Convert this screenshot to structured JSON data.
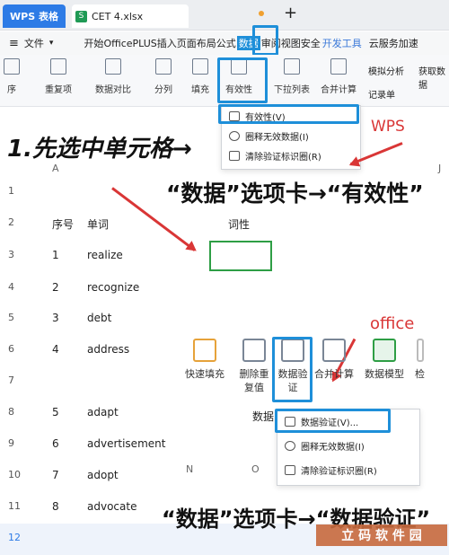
{
  "titlebar": {
    "app_tab": "WPS 表格",
    "file_tab": "CET 4.xlsx",
    "new_tab": "+"
  },
  "menubar": {
    "file_menu": "文件",
    "items": [
      "开始",
      "OfficePLUS",
      "插入",
      "页面布局",
      "公式",
      "数据",
      "审阅",
      "视图",
      "安全",
      "开发工具",
      "云服务",
      "加速"
    ],
    "highlighted_tab": "数据"
  },
  "ribbon": {
    "left_labels": [
      "序",
      "重复项",
      "数据对比",
      "分列",
      "填充",
      "有效性",
      "下拉列表",
      "合并计算",
      "记录单"
    ],
    "extra_labels": [
      "模拟分析",
      "获取数据"
    ]
  },
  "wps_dropdown": {
    "items": [
      {
        "label": "有效性(V)",
        "icon": "validity-icon"
      },
      {
        "label": "圈释无效数据(I)",
        "icon": "circle-invalid-icon"
      },
      {
        "label": "清除验证标识圈(R)",
        "icon": "clear-circles-icon"
      }
    ],
    "tag": "WPS"
  },
  "annotations": {
    "step1": "1.先选中单元格→",
    "step2_wps": "“数据”选项卡→“有效性”",
    "step2_office": "“数据”选项卡→“数据验证”",
    "office_tag": "office"
  },
  "sheet": {
    "col_a": "A",
    "col_j": "J",
    "col_n": "N",
    "col_o": "O",
    "header": {
      "seq": "序号",
      "word": "单词",
      "pos": "词性"
    },
    "rows": [
      {
        "row": "1",
        "seq": "",
        "word": ""
      },
      {
        "row": "2",
        "seq": "序号",
        "word": "单词"
      },
      {
        "row": "3",
        "seq": "1",
        "word": "realize"
      },
      {
        "row": "4",
        "seq": "2",
        "word": "recognize"
      },
      {
        "row": "5",
        "seq": "3",
        "word": "debt"
      },
      {
        "row": "6",
        "seq": "4",
        "word": "address"
      },
      {
        "row": "7",
        "seq": "",
        "word": ""
      },
      {
        "row": "8",
        "seq": "5",
        "word": "adapt"
      },
      {
        "row": "9",
        "seq": "6",
        "word": "advertisement"
      },
      {
        "row": "10",
        "seq": "7",
        "word": "adopt"
      },
      {
        "row": "11",
        "seq": "8",
        "word": "advocate"
      },
      {
        "row": "12",
        "seq": "",
        "word": ""
      }
    ]
  },
  "office_ribbon": {
    "items": [
      "快速填充",
      "删除重复值",
      "数据验证",
      "合并计算",
      "数据模型",
      "检"
    ],
    "data_label": "数据",
    "dropdown": [
      {
        "label": "数据验证(V)...",
        "icon": "data-validation-icon"
      },
      {
        "label": "圈释无效数据(I)",
        "icon": "circle-invalid-icon"
      },
      {
        "label": "清除验证标识圈(R)",
        "icon": "clear-circles-icon"
      }
    ]
  },
  "watermark": "立 码 软 件 园",
  "colors": {
    "accent": "#1e8fd9",
    "arrow": "#d93636",
    "green_box": "#2e9e45",
    "wps_blue": "#2d7be6"
  }
}
